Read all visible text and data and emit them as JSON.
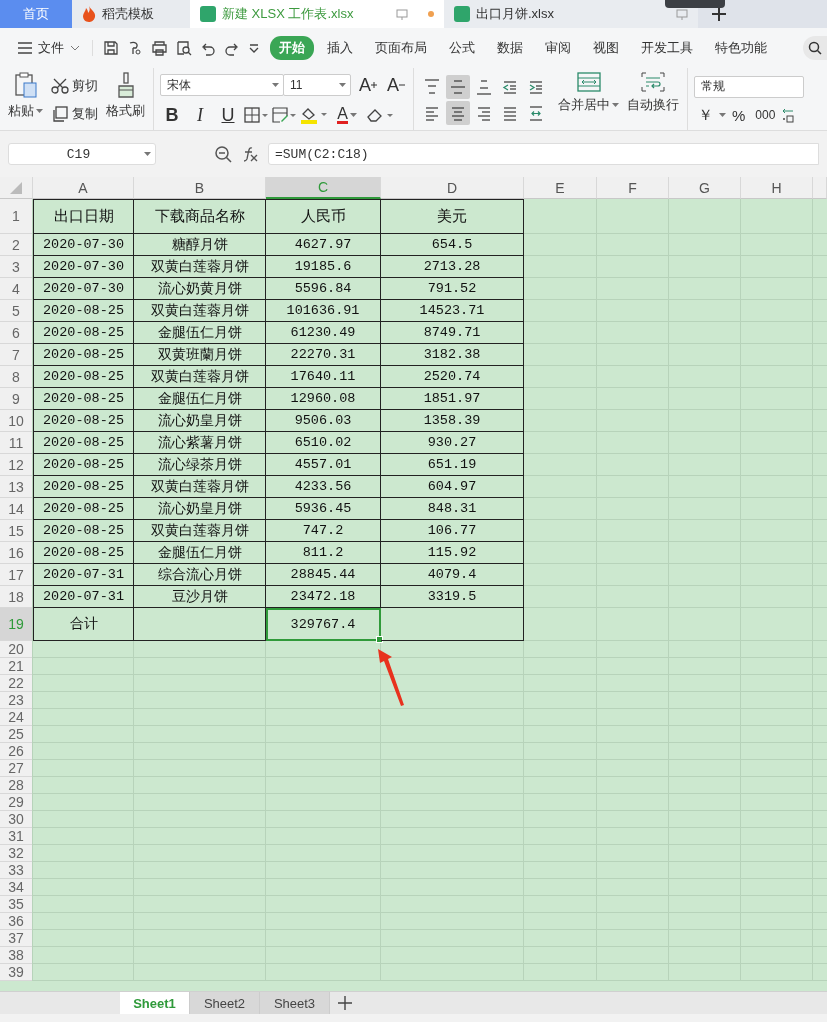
{
  "tabs": [
    {
      "label": "首页",
      "kind": "home",
      "selected": false,
      "modified": false
    },
    {
      "label": "稻壳模板",
      "kind": "template",
      "selected": false,
      "modified": false
    },
    {
      "label": "新建 XLSX 工作表.xlsx",
      "kind": "sheet",
      "selected": true,
      "modified": true
    },
    {
      "label": "出口月饼.xlsx",
      "kind": "sheet",
      "selected": false,
      "modified": false
    }
  ],
  "menu": {
    "file_label": "文件",
    "ribbon_tabs": [
      {
        "label": "开始",
        "selected": true
      },
      {
        "label": "插入",
        "selected": false
      },
      {
        "label": "页面布局",
        "selected": false
      },
      {
        "label": "公式",
        "selected": false
      },
      {
        "label": "数据",
        "selected": false
      },
      {
        "label": "审阅",
        "selected": false
      },
      {
        "label": "视图",
        "selected": false
      },
      {
        "label": "开发工具",
        "selected": false
      },
      {
        "label": "特色功能",
        "selected": false
      }
    ]
  },
  "ribbon": {
    "paste": "粘贴",
    "cut": "剪切",
    "copy": "复制",
    "format_painter": "格式刷",
    "font_name": "宋体",
    "font_size": "11",
    "font_buttons": [
      {
        "label": "A",
        "kind": "grow"
      },
      {
        "label": "A",
        "kind": "shrink"
      }
    ],
    "style_buttons": [
      {
        "label": "B",
        "kind": "bold"
      },
      {
        "label": "I",
        "kind": "italic"
      },
      {
        "label": "U",
        "kind": "underline"
      }
    ],
    "text_color_label": "A",
    "align_buttons": [
      {
        "kind": "top",
        "selected": false
      },
      {
        "kind": "middle",
        "selected": true
      },
      {
        "kind": "bottom",
        "selected": false
      },
      {
        "kind": "outdent",
        "selected": false
      },
      {
        "kind": "indent",
        "selected": false
      },
      {
        "kind": "left",
        "selected": false
      },
      {
        "kind": "center",
        "selected": true
      },
      {
        "kind": "right",
        "selected": false
      },
      {
        "kind": "justify",
        "selected": false
      },
      {
        "kind": "distributed",
        "selected": false
      }
    ],
    "merge": "合并居中",
    "wrap": "自动换行",
    "number_format": "常规",
    "number_buttons": [
      "￥",
      "%",
      "000"
    ]
  },
  "formula_bar": {
    "cell_ref": "C19",
    "formula": "=SUM(C2:C18)"
  },
  "columns": [
    {
      "label": "A",
      "selected": false
    },
    {
      "label": "B",
      "selected": false
    },
    {
      "label": "C",
      "selected": true
    },
    {
      "label": "D",
      "selected": false
    },
    {
      "label": "E",
      "selected": false
    },
    {
      "label": "F",
      "selected": false
    },
    {
      "label": "G",
      "selected": false
    },
    {
      "label": "H",
      "selected": false
    }
  ],
  "rows": [
    {
      "number": "1",
      "kind": "header",
      "selected": false,
      "cells": [
        "出口日期",
        "下载商品名称",
        "人民币",
        "美元"
      ]
    },
    {
      "number": "2",
      "kind": "data",
      "selected": false,
      "cells": [
        "2020-07-30",
        "糖醇月饼",
        "4627.97",
        "654.5"
      ]
    },
    {
      "number": "3",
      "kind": "data",
      "selected": false,
      "cells": [
        "2020-07-30",
        "双黄白莲蓉月饼",
        "19185.6",
        "2713.28"
      ]
    },
    {
      "number": "4",
      "kind": "data",
      "selected": false,
      "cells": [
        "2020-07-30",
        "流心奶黄月饼",
        "5596.84",
        "791.52"
      ]
    },
    {
      "number": "5",
      "kind": "data",
      "selected": false,
      "cells": [
        "2020-08-25",
        "双黄白莲蓉月饼",
        "101636.91",
        "14523.71"
      ]
    },
    {
      "number": "6",
      "kind": "data",
      "selected": false,
      "cells": [
        "2020-08-25",
        "金腿伍仁月饼",
        "61230.49",
        "8749.71"
      ]
    },
    {
      "number": "7",
      "kind": "data",
      "selected": false,
      "cells": [
        "2020-08-25",
        "双黄班蘭月饼",
        "22270.31",
        "3182.38"
      ]
    },
    {
      "number": "8",
      "kind": "data",
      "selected": false,
      "cells": [
        "2020-08-25",
        "双黄白莲蓉月饼",
        "17640.11",
        "2520.74"
      ]
    },
    {
      "number": "9",
      "kind": "data",
      "selected": false,
      "cells": [
        "2020-08-25",
        "金腿伍仁月饼",
        "12960.08",
        "1851.97"
      ]
    },
    {
      "number": "10",
      "kind": "data",
      "selected": false,
      "cells": [
        "2020-08-25",
        "流心奶皇月饼",
        "9506.03",
        "1358.39"
      ]
    },
    {
      "number": "11",
      "kind": "data",
      "selected": false,
      "cells": [
        "2020-08-25",
        "流心紫薯月饼",
        "6510.02",
        "930.27"
      ]
    },
    {
      "number": "12",
      "kind": "data",
      "selected": false,
      "cells": [
        "2020-08-25",
        "流心绿茶月饼",
        "4557.01",
        "651.19"
      ]
    },
    {
      "number": "13",
      "kind": "data",
      "selected": false,
      "cells": [
        "2020-08-25",
        "双黄白莲蓉月饼",
        "4233.56",
        "604.97"
      ]
    },
    {
      "number": "14",
      "kind": "data",
      "selected": false,
      "cells": [
        "2020-08-25",
        "流心奶皇月饼",
        "5936.45",
        "848.31"
      ]
    },
    {
      "number": "15",
      "kind": "data",
      "selected": false,
      "cells": [
        "2020-08-25",
        "双黄白莲蓉月饼",
        "747.2",
        "106.77"
      ]
    },
    {
      "number": "16",
      "kind": "data",
      "selected": false,
      "cells": [
        "2020-08-25",
        "金腿伍仁月饼",
        "811.2",
        "115.92"
      ]
    },
    {
      "number": "17",
      "kind": "data",
      "selected": false,
      "cells": [
        "2020-07-31",
        "综合流心月饼",
        "28845.44",
        "4079.4"
      ]
    },
    {
      "number": "18",
      "kind": "data",
      "selected": false,
      "cells": [
        "2020-07-31",
        "豆沙月饼",
        "23472.18",
        "3319.5"
      ]
    },
    {
      "number": "19",
      "kind": "total",
      "selected": true,
      "cells": [
        {
          "text": "合计",
          "selected": false
        },
        {
          "selected": false
        },
        {
          "text": "329767.4",
          "selected": true
        },
        {
          "selected": false
        }
      ]
    }
  ],
  "empty_rows": [
    "20",
    "21",
    "22",
    "23",
    "24",
    "25",
    "26",
    "27",
    "28",
    "29",
    "30",
    "31",
    "32",
    "33",
    "34",
    "35",
    "36",
    "37",
    "38",
    "39"
  ],
  "sheet_tabs": [
    {
      "label": "Sheet1",
      "selected": true
    },
    {
      "label": "Sheet2",
      "selected": false
    },
    {
      "label": "Sheet3",
      "selected": false
    }
  ]
}
